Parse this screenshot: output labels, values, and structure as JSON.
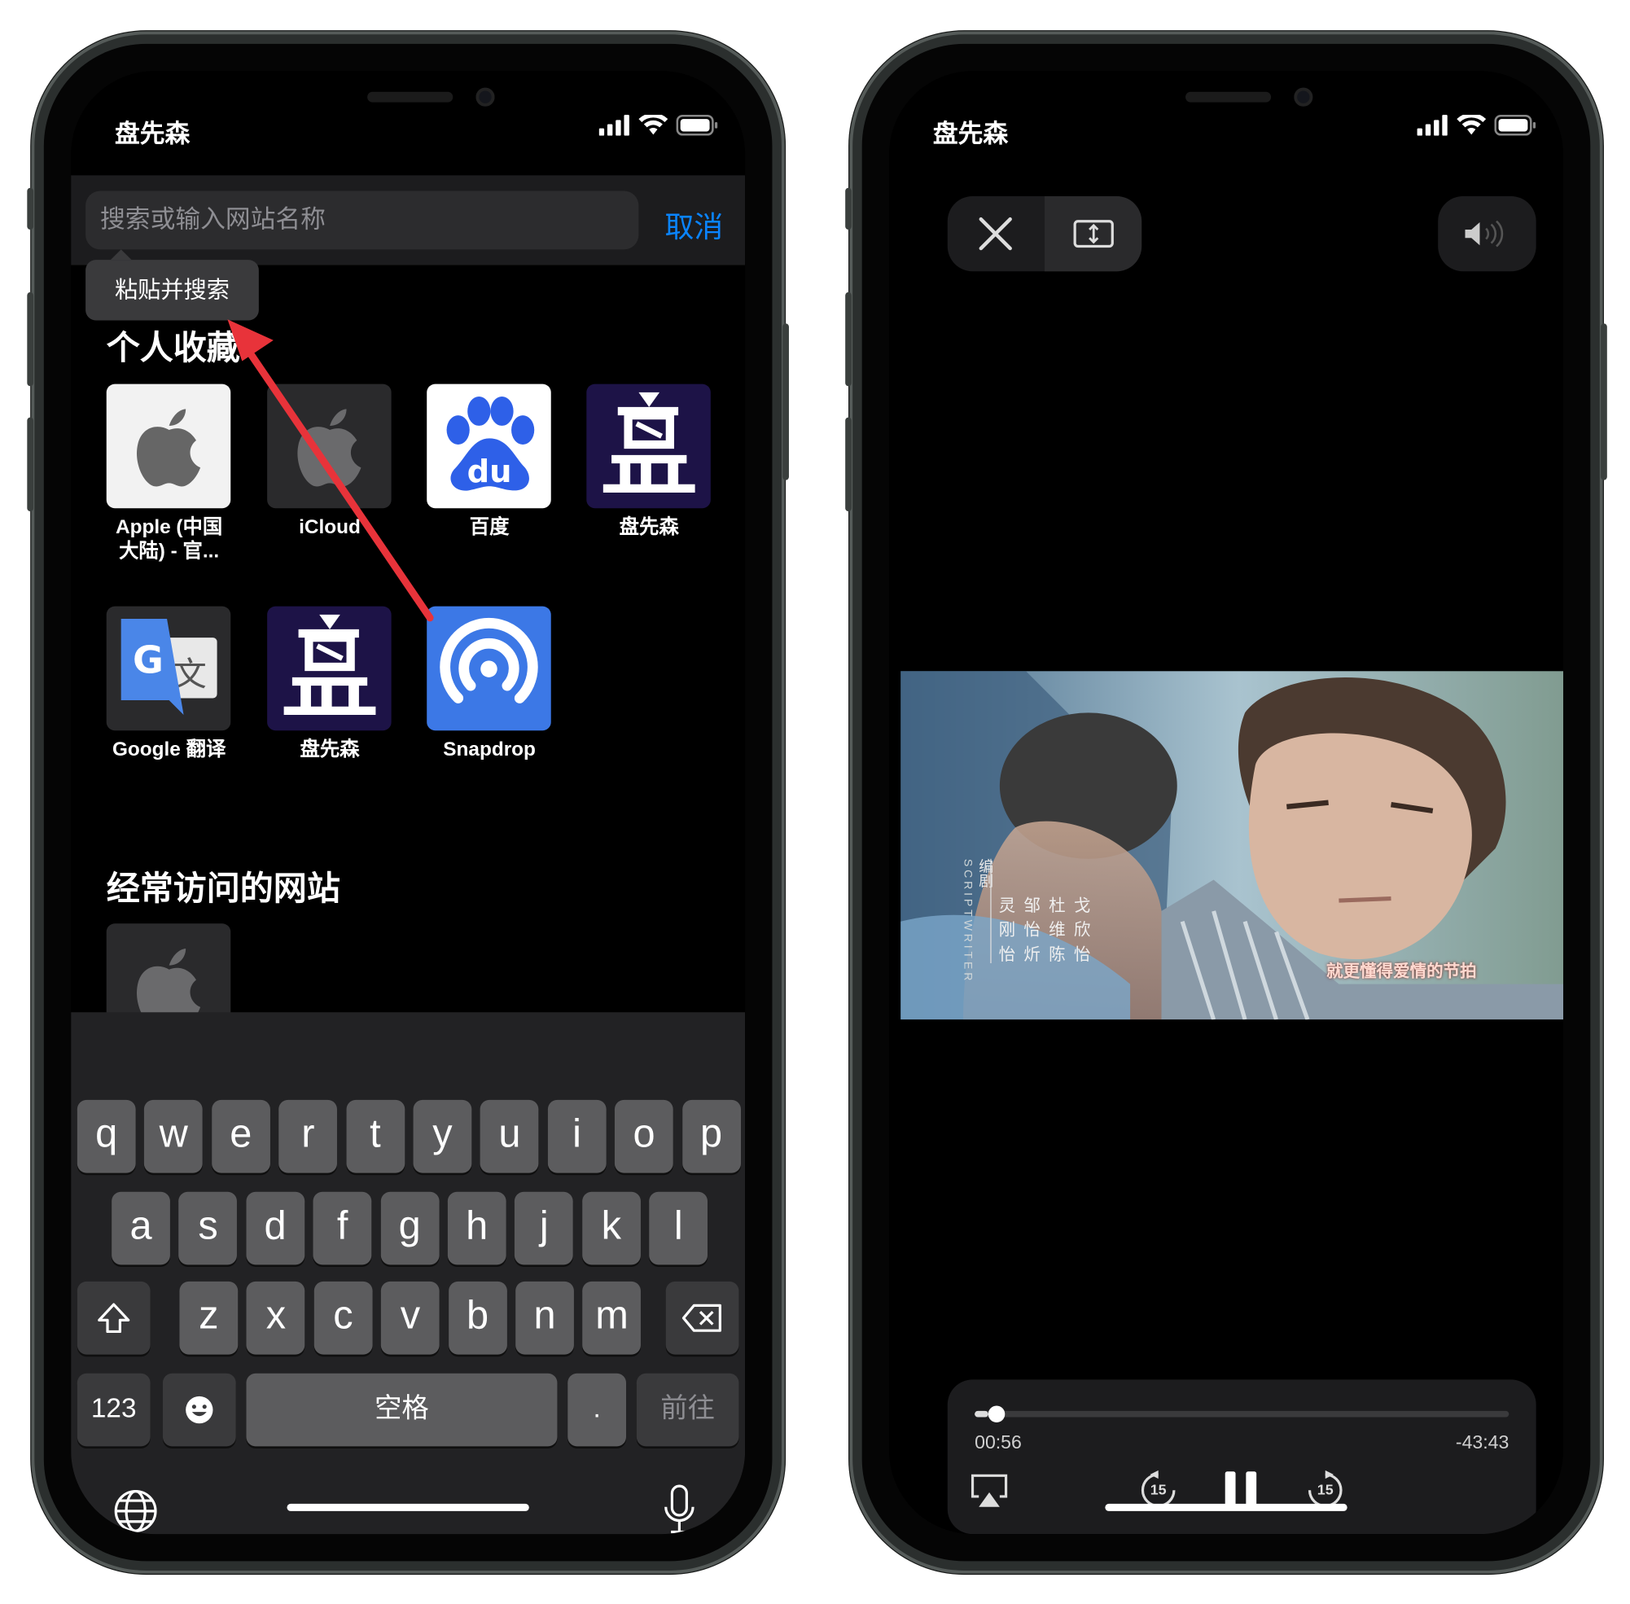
{
  "left_phone": {
    "status": {
      "carrier": "盘先森"
    },
    "search": {
      "placeholder": "搜索或输入网站名称",
      "cancel": "取消"
    },
    "paste_popup": "粘贴并搜索",
    "favorites": {
      "title": "个人收藏",
      "items": [
        {
          "label": "Apple (中国\n大陆) - 官...",
          "line1": "Apple (中国",
          "line2": "大陆) - 官...",
          "icon": "apple-icon"
        },
        {
          "label": "iCloud",
          "icon": "apple-icon"
        },
        {
          "label": "百度",
          "icon": "baidu-paw-icon"
        },
        {
          "label": "盘先森",
          "icon": "pan-logo-icon"
        },
        {
          "label": "Google 翻译",
          "icon": "google-translate-icon"
        },
        {
          "label": "盘先森",
          "icon": "pan-logo-icon"
        },
        {
          "label": "Snapdrop",
          "icon": "snapdrop-icon"
        }
      ]
    },
    "frequent": {
      "title": "经常访问的网站"
    },
    "keyboard": {
      "row1": [
        "q",
        "w",
        "e",
        "r",
        "t",
        "y",
        "u",
        "i",
        "o",
        "p"
      ],
      "row2": [
        "a",
        "s",
        "d",
        "f",
        "g",
        "h",
        "j",
        "k",
        "l"
      ],
      "row3": [
        "z",
        "x",
        "c",
        "v",
        "b",
        "n",
        "m"
      ],
      "numbers": "123",
      "space": "空格",
      "period": ".",
      "go": "前往"
    },
    "annotation_color": "#e8333a"
  },
  "right_phone": {
    "status": {
      "carrier": "盘先森"
    },
    "video": {
      "credits_small": "编剧",
      "credits_scriptwriter": "SCRIPTWRITER",
      "credits_names": [
        "戈",
        "杜",
        "邹",
        "灵",
        "欣",
        "维",
        "怡",
        "刚",
        "怡",
        "陈",
        "炘",
        "怡"
      ],
      "subtitle": "就更懂得爱情的节拍"
    },
    "player": {
      "elapsed": "00:56",
      "remaining": "-43:43",
      "progress": 0.026,
      "skip_back": "15",
      "skip_forward": "15"
    }
  }
}
